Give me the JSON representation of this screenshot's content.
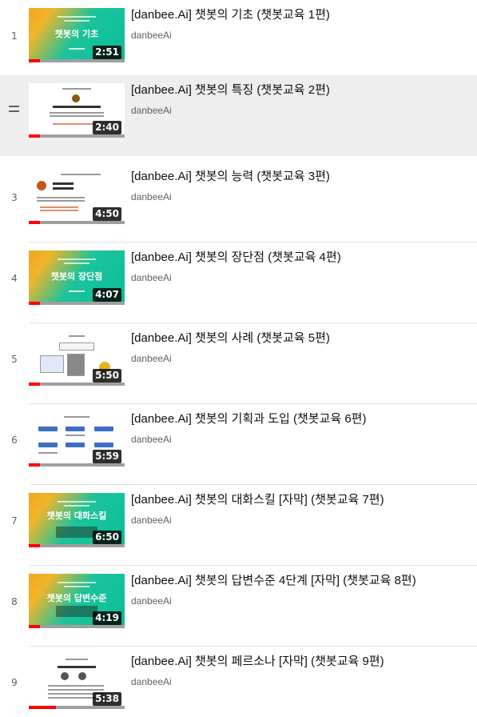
{
  "playlist": {
    "items": [
      {
        "index": "1",
        "title": "[danbee.Ai] 챗봇의 기초 (챗봇교육 1편)",
        "channel": "danbeeAi",
        "duration": "2:51",
        "progress": 0.12,
        "thumb_text": "챗봇의 기초",
        "thumb_style": "gradient"
      },
      {
        "index": "",
        "title": "[danbee.Ai] 챗봇의 특징 (챗봇교육 2편)",
        "channel": "danbeeAi",
        "duration": "2:40",
        "progress": 0.12,
        "thumb_text": "",
        "thumb_style": "doc"
      },
      {
        "index": "3",
        "title": "[danbee.Ai] 챗봇의 능력 (챗봇교육 3편)",
        "channel": "danbeeAi",
        "duration": "4:50",
        "progress": 0.12,
        "thumb_text": "",
        "thumb_style": "doc"
      },
      {
        "index": "4",
        "title": "[danbee.Ai] 챗봇의 장단점 (챗봇교육 4편)",
        "channel": "danbeeAi",
        "duration": "4:07",
        "progress": 0.12,
        "thumb_text": "챗봇의 장단점",
        "thumb_style": "gradient"
      },
      {
        "index": "5",
        "title": "[danbee.Ai] 챗봇의 사례 (챗봇교육 5편)",
        "channel": "danbeeAi",
        "duration": "5:50",
        "progress": 0.12,
        "thumb_text": "",
        "thumb_style": "doc"
      },
      {
        "index": "6",
        "title": "[danbee.Ai] 챗봇의 기획과 도입 (챗봇교육 6편)",
        "channel": "danbeeAi",
        "duration": "5:59",
        "progress": 0.12,
        "thumb_text": "",
        "thumb_style": "doc"
      },
      {
        "index": "7",
        "title": "[danbee.Ai] 챗봇의 대화스킬 [자막] (챗봇교육 7편)",
        "channel": "danbeeAi",
        "duration": "6:50",
        "progress": 0.12,
        "thumb_text": "챗봇의 대화스킬",
        "thumb_style": "gradient"
      },
      {
        "index": "8",
        "title": "[danbee.Ai] 챗봇의 답변수준 4단계 [자막] (챗봇교육 8편)",
        "channel": "danbeeAi",
        "duration": "4:19",
        "progress": 0.12,
        "thumb_text": "챗봇의 답변수준",
        "thumb_style": "gradient"
      },
      {
        "index": "9",
        "title": "[danbee.Ai] 챗봇의 페르소나 [자막] (챗봇교육 9편)",
        "channel": "danbeeAi",
        "duration": "5:38",
        "progress": 0.28,
        "thumb_text": "",
        "thumb_style": "doc"
      }
    ],
    "active_index": 1,
    "active_icon": "drag-handle-icon"
  }
}
